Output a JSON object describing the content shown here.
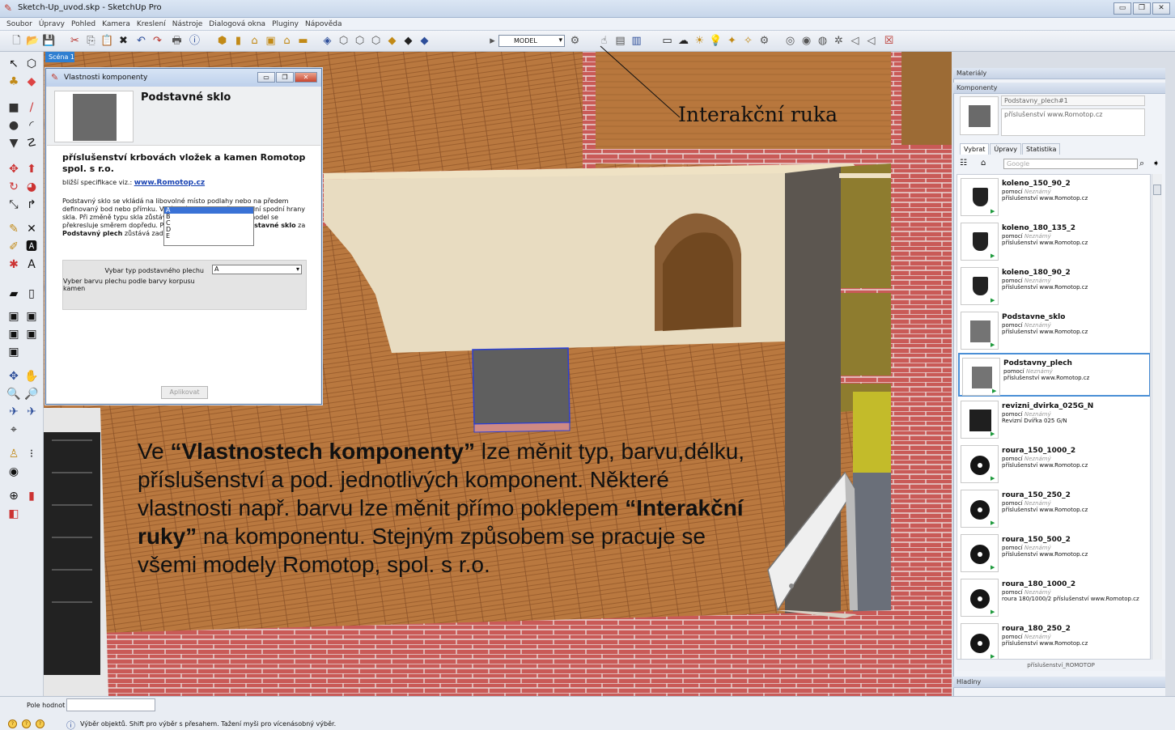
{
  "window": {
    "title": "Sketch-Up_uvod.skp - SketchUp Pro",
    "controls": [
      "▭",
      "❐",
      "✕"
    ]
  },
  "menu": [
    "Soubor",
    "Úpravy",
    "Pohled",
    "Kamera",
    "Kreslení",
    "Nástroje",
    "Dialogová okna",
    "Pluginy",
    "Nápověda"
  ],
  "toolbar": {
    "layer_value": "MODEL"
  },
  "scene_tab": "Scéna 1",
  "annotations": {
    "hand_label": "Interakční ruka",
    "desc_1": "Ve ",
    "desc_b1": "“Vlastnostech komponenty”",
    "desc_2": " lze měnit typ, barvu,délku, příslušenství a pod. jednotlivých komponent. Některé vlastnosti např. barvu lze měnit přímo poklepem ",
    "desc_b2": "“Interakční ruky”",
    "desc_3": " na komponentu. Stejným způsobem se pracuje se všemi modely Romotop, spol. s r.o."
  },
  "dialog": {
    "title": "Vlastnosti komponenty",
    "name": "Podstavné sklo",
    "heading": "příslušenství krbovách vložek a kamen Romotop spol. s r.o.",
    "spec_label": "bližší specifikace viz.: ",
    "spec_link": "www.Romotop.cz",
    "p1": "Podstavný sklo se vkládá na libovolné místo podlahy nebo na předem definovaný bod nebo přímku. Vkládací bod je ve středu zadní spodní hrany skla. Při změně typu skla zůstává zadní hrana na místě a model se překresluje směrem dopředu. Při záměně komponenty ",
    "p1b": "Podstavné sklo",
    "p2": " za ",
    "p2b": "Podstavný plech",
    "p3": " zůstává zadní hrana zakotvena.",
    "select_label": "Vybar typ podstavného plechu",
    "color_label": "Vyber barvu plechu podle barvy korpusu kamen",
    "select_value": "A",
    "options": [
      "A",
      "B",
      "C",
      "D",
      "E"
    ],
    "apply_label": "Aplikovat"
  },
  "panel": {
    "materials": "Materiály",
    "components": "Komponenty",
    "component_name": "Podstavny_plech#1",
    "component_desc": "příslušenství www.Romotop.cz",
    "tabs": [
      "Vybrat",
      "Úpravy",
      "Statistika"
    ],
    "search_placeholder": "Google",
    "items": [
      {
        "name": "koleno_150_90_2",
        "by": "pomocí",
        "author": "Neznámý",
        "desc": "příslušenství www.Romotop.cz",
        "icon": "pipe-elbow-icon"
      },
      {
        "name": "koleno_180_135_2",
        "by": "pomocí",
        "author": "Neznámý",
        "desc": "příslušenství www.Romotop.cz",
        "icon": "pipe-elbow-icon"
      },
      {
        "name": "koleno_180_90_2",
        "by": "pomocí",
        "author": "Neznámý",
        "desc": "příslušenství www.Romotop.cz",
        "icon": "pipe-elbow-icon"
      },
      {
        "name": "Podstavne_sklo",
        "by": "pomocí",
        "author": "Neznámý",
        "desc": "příslušenství www.Romotop.cz",
        "icon": "glass-plate-icon"
      },
      {
        "name": "Podstavny_plech",
        "by": "pomocí",
        "author": "Neznámý",
        "desc": "příslušenství www.Romotop.cz",
        "icon": "steel-plate-icon"
      },
      {
        "name": "revizni_dvirka_025G_N",
        "by": "pomocí",
        "author": "Neznámý",
        "desc": "Revizní Dvířka 025 G/N",
        "icon": "revision-door-icon"
      },
      {
        "name": "roura_150_1000_2",
        "by": "pomocí",
        "author": "Neznámý",
        "desc": "příslušenství www.Romotop.cz",
        "icon": "pipe-ring-icon"
      },
      {
        "name": "roura_150_250_2",
        "by": "pomocí",
        "author": "Neznámý",
        "desc": "příslušenství www.Romotop.cz",
        "icon": "pipe-ring-icon"
      },
      {
        "name": "roura_150_500_2",
        "by": "pomocí",
        "author": "Neznámý",
        "desc": "příslušenství www.Romotop.cz",
        "icon": "pipe-ring-icon"
      },
      {
        "name": "roura_180_1000_2",
        "by": "pomocí",
        "author": "Neznámý",
        "desc": "roura 180/1000/2 příslušenství www.Romotop.cz",
        "icon": "pipe-ring-icon"
      },
      {
        "name": "roura_180_250_2",
        "by": "pomocí",
        "author": "Neznámý",
        "desc": "příslušenství www.Romotop.cz",
        "icon": "pipe-ring-icon"
      }
    ],
    "footer": "příslušenství_ROMOTOP",
    "layers": "Hladiny"
  },
  "status": {
    "vcb_label": "Pole hodnot",
    "text": "Výběr objektů. Shift pro výběr s přesahem. Tažení myši pro vícenásobný výběr."
  }
}
